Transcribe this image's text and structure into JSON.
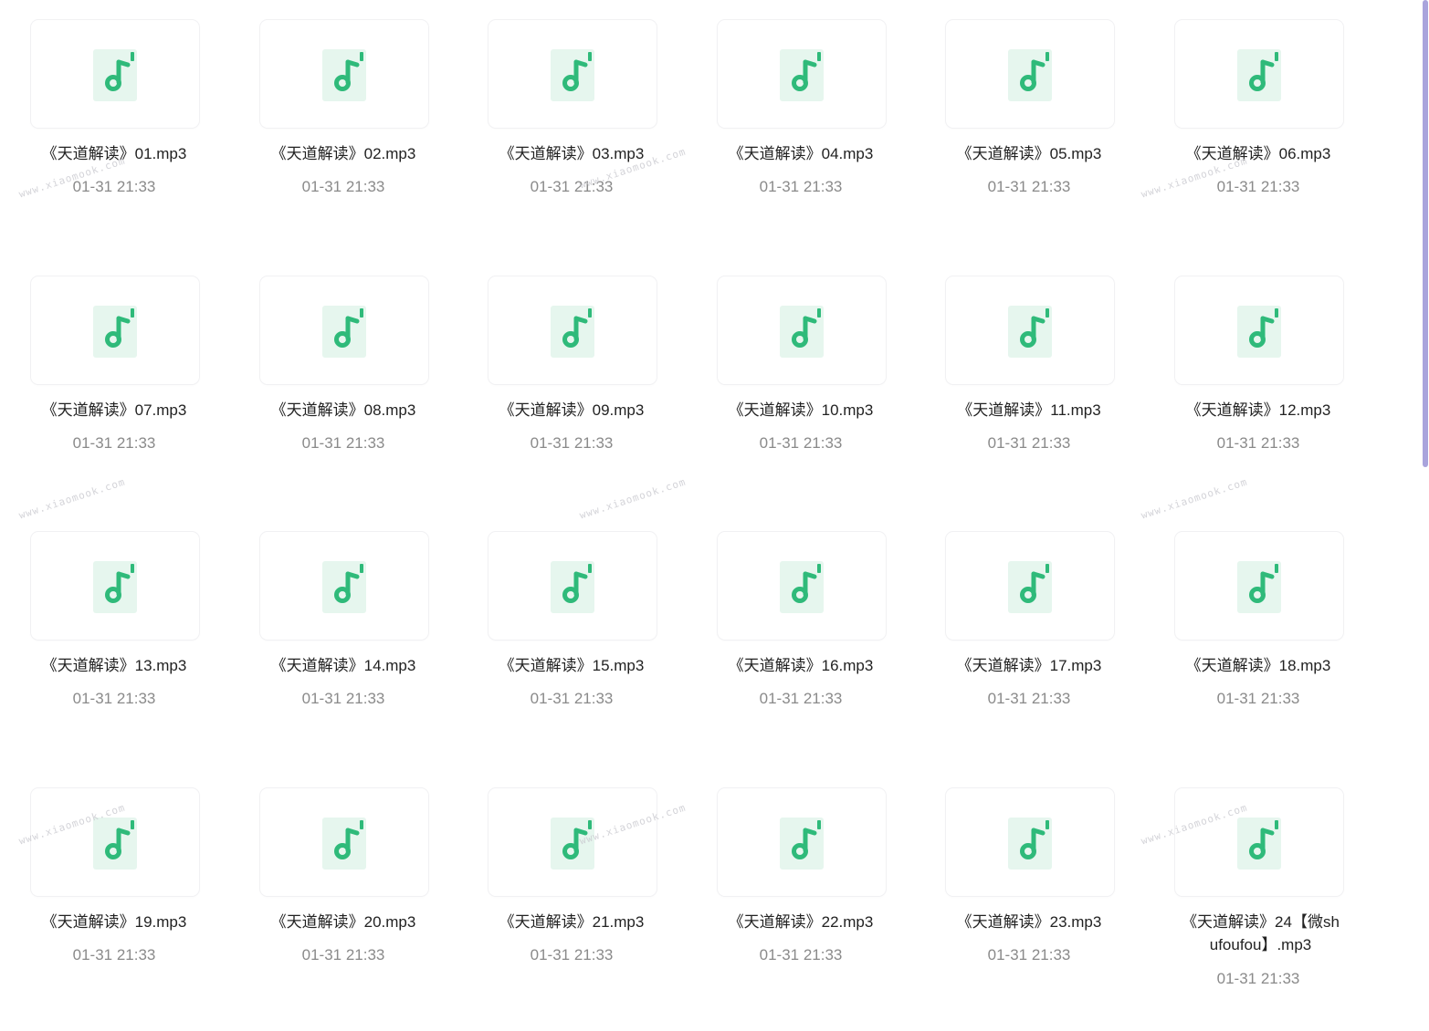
{
  "files": [
    {
      "name": "《天道解读》01.mp3",
      "date": "01-31 21:33",
      "icon": "music-file-icon"
    },
    {
      "name": "《天道解读》02.mp3",
      "date": "01-31 21:33",
      "icon": "music-file-icon"
    },
    {
      "name": "《天道解读》03.mp3",
      "date": "01-31 21:33",
      "icon": "music-file-icon"
    },
    {
      "name": "《天道解读》04.mp3",
      "date": "01-31 21:33",
      "icon": "music-file-icon"
    },
    {
      "name": "《天道解读》05.mp3",
      "date": "01-31 21:33",
      "icon": "music-file-icon"
    },
    {
      "name": "《天道解读》06.mp3",
      "date": "01-31 21:33",
      "icon": "music-file-icon"
    },
    {
      "name": "《天道解读》07.mp3",
      "date": "01-31 21:33",
      "icon": "music-file-icon"
    },
    {
      "name": "《天道解读》08.mp3",
      "date": "01-31 21:33",
      "icon": "music-file-icon"
    },
    {
      "name": "《天道解读》09.mp3",
      "date": "01-31 21:33",
      "icon": "music-file-icon"
    },
    {
      "name": "《天道解读》10.mp3",
      "date": "01-31 21:33",
      "icon": "music-file-icon"
    },
    {
      "name": "《天道解读》11.mp3",
      "date": "01-31 21:33",
      "icon": "music-file-icon"
    },
    {
      "name": "《天道解读》12.mp3",
      "date": "01-31 21:33",
      "icon": "music-file-icon"
    },
    {
      "name": "《天道解读》13.mp3",
      "date": "01-31 21:33",
      "icon": "music-file-icon"
    },
    {
      "name": "《天道解读》14.mp3",
      "date": "01-31 21:33",
      "icon": "music-file-icon"
    },
    {
      "name": "《天道解读》15.mp3",
      "date": "01-31 21:33",
      "icon": "music-file-icon"
    },
    {
      "name": "《天道解读》16.mp3",
      "date": "01-31 21:33",
      "icon": "music-file-icon"
    },
    {
      "name": "《天道解读》17.mp3",
      "date": "01-31 21:33",
      "icon": "music-file-icon"
    },
    {
      "name": "《天道解读》18.mp3",
      "date": "01-31 21:33",
      "icon": "music-file-icon"
    },
    {
      "name": "《天道解读》19.mp3",
      "date": "01-31 21:33",
      "icon": "music-file-icon"
    },
    {
      "name": "《天道解读》20.mp3",
      "date": "01-31 21:33",
      "icon": "music-file-icon"
    },
    {
      "name": "《天道解读》21.mp3",
      "date": "01-31 21:33",
      "icon": "music-file-icon"
    },
    {
      "name": "《天道解读》22.mp3",
      "date": "01-31 21:33",
      "icon": "music-file-icon"
    },
    {
      "name": "《天道解读》23.mp3",
      "date": "01-31 21:33",
      "icon": "music-file-icon"
    },
    {
      "name": "《天道解读》24【微shufoufou】.mp3",
      "date": "01-31 21:33",
      "icon": "music-file-icon"
    }
  ],
  "watermark": "www.xiaomook.com",
  "colors": {
    "icon_green": "#2fba7a",
    "icon_bg": "#e6f6ee",
    "name_text": "#222222",
    "date_text": "#8a8a8a",
    "scrollbar": "#a9a4dc"
  }
}
